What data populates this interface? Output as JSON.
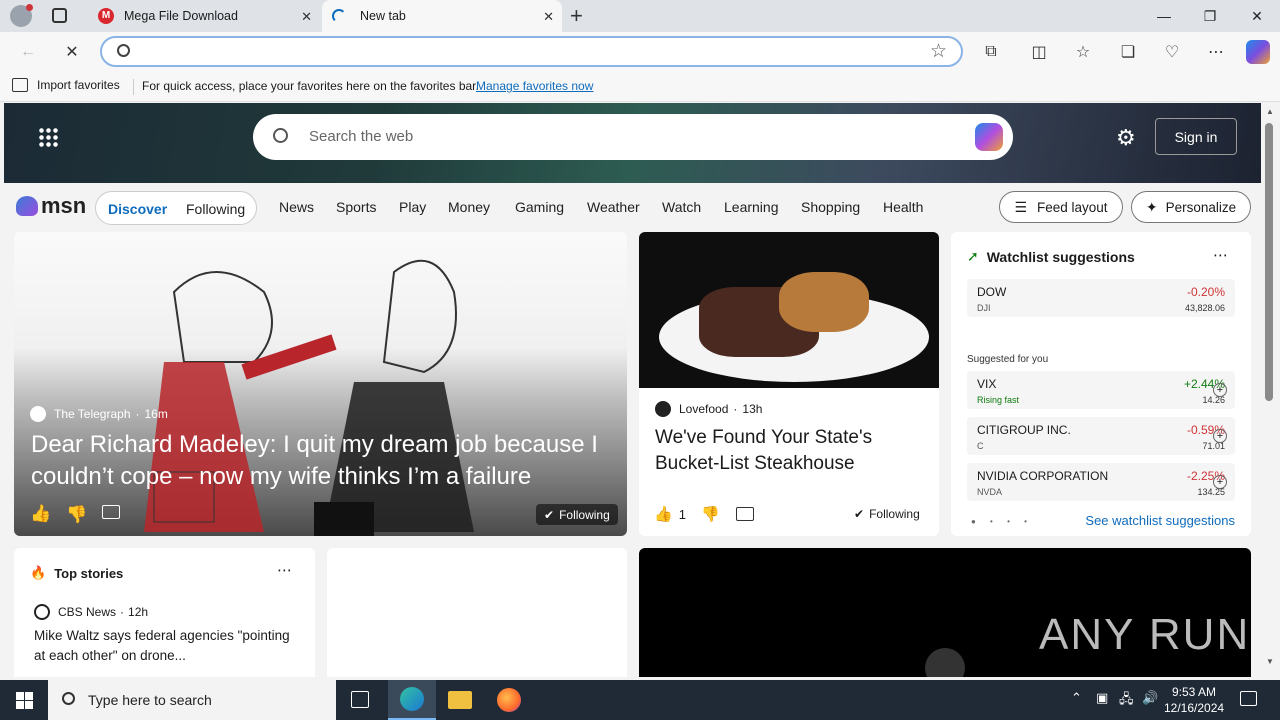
{
  "tabs": [
    {
      "title": "Mega File Download",
      "close": "✕"
    },
    {
      "title": "New tab",
      "close": "✕"
    }
  ],
  "new_tab": "+",
  "window": {
    "minimize": "—",
    "restore": "❐",
    "close": "✕"
  },
  "favorites_bar": {
    "import_label": "Import favorites",
    "message": "For quick access, place your favorites here on the favorites bar.",
    "manage_link": "Manage favorites now"
  },
  "msn": {
    "search_placeholder": "Search the web",
    "sign_in": "Sign in",
    "logo_text": "msn",
    "toggle": [
      "Discover",
      "Following"
    ],
    "nav": [
      "News",
      "Sports",
      "Play",
      "Money",
      "Gaming",
      "Weather",
      "Watch",
      "Learning",
      "Shopping",
      "Health"
    ],
    "feed_layout": "Feed layout",
    "personalize": "Personalize"
  },
  "hero_card": {
    "source": "The Telegraph",
    "age": "16m",
    "headline": "Dear Richard Madeley: I quit my dream job because I couldn’t cope – now my wife thinks I’m a failure",
    "following": "Following"
  },
  "food_card": {
    "source": "Lovefood",
    "age": "13h",
    "headline": "We've Found Your State's Bucket-List Steakhouse",
    "likes": "1",
    "following": "Following"
  },
  "watchlist": {
    "title": "Watchlist suggestions",
    "main": {
      "name": "DOW",
      "ticker": "DJI",
      "change": "-0.20%",
      "price": "43,828.06"
    },
    "suggested_label": "Suggested for you",
    "items": [
      {
        "name": "VIX",
        "ticker": "Rising fast",
        "change": "+2.44%",
        "price": "14.26"
      },
      {
        "name": "CITIGROUP INC.",
        "ticker": "C",
        "change": "-0.59%",
        "price": "71.01"
      },
      {
        "name": "NVIDIA CORPORATION",
        "ticker": "NVDA",
        "change": "-2.25%",
        "price": "134.25"
      }
    ],
    "see_link": "See watchlist suggestions"
  },
  "top_stories": {
    "title": "Top stories",
    "source": "CBS News",
    "age": "12h",
    "headline": "Mike Waltz says federal agencies \"pointing at each other\" on drone..."
  },
  "watermark": "ANY RUN",
  "taskbar": {
    "search_placeholder": "Type here to search",
    "time": "9:53 AM",
    "date": "12/16/2024"
  },
  "colors": {
    "accent": "#0f6cbd",
    "negative": "#d13438",
    "positive": "#107c10"
  }
}
